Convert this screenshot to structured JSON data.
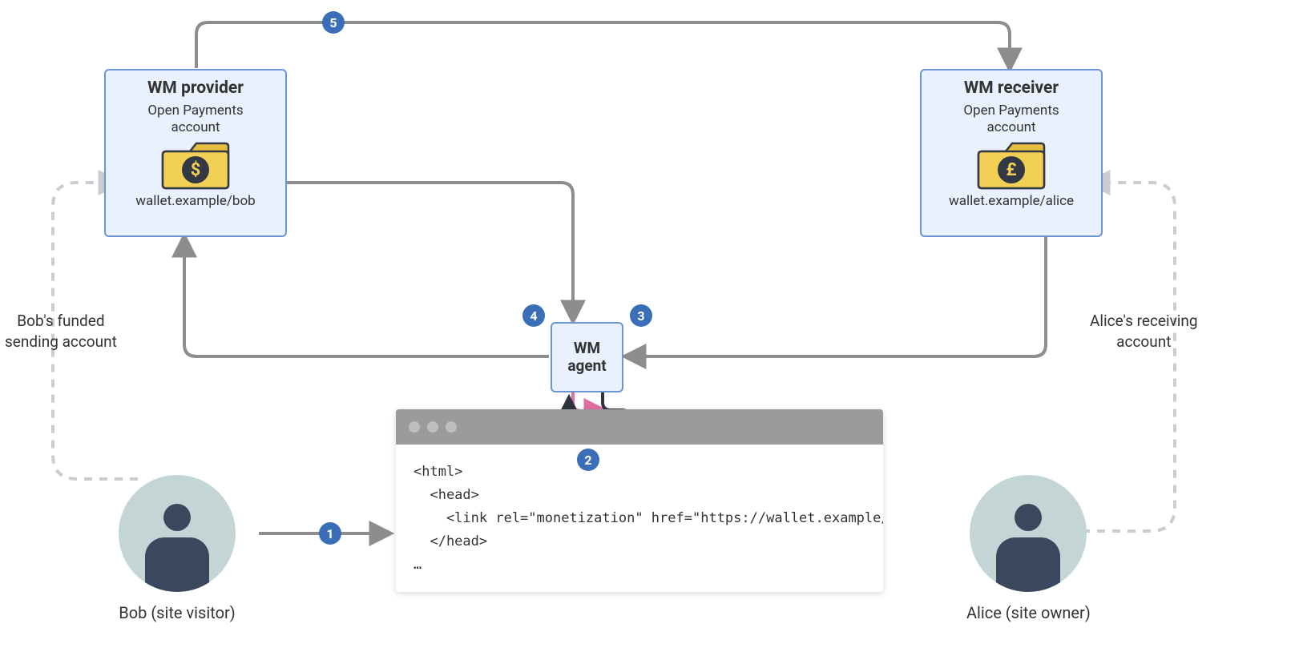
{
  "provider": {
    "title": "WM provider",
    "account_label": "Open Payments account",
    "wallet": "wallet.example/bob",
    "currency_symbol": "$"
  },
  "receiver": {
    "title": "WM receiver",
    "account_label": "Open Payments account",
    "wallet": "wallet.example/alice",
    "currency_symbol": "£"
  },
  "agent": {
    "line1": "WM",
    "line2": "agent"
  },
  "browser": {
    "code": "<html>\n  <head>\n    <link rel=\"monetization\" href=\"https://wallet.example/alice\">\n  </head>\n…"
  },
  "bob": {
    "label": "Bob (site visitor)"
  },
  "alice": {
    "label": "Alice (site owner)"
  },
  "labels": {
    "bob_account": "Bob's funded\nsending account",
    "alice_account": "Alice's receiving\naccount"
  },
  "steps": {
    "s1": "1",
    "s2": "2",
    "s3": "3",
    "s4": "4",
    "s5": "5"
  }
}
